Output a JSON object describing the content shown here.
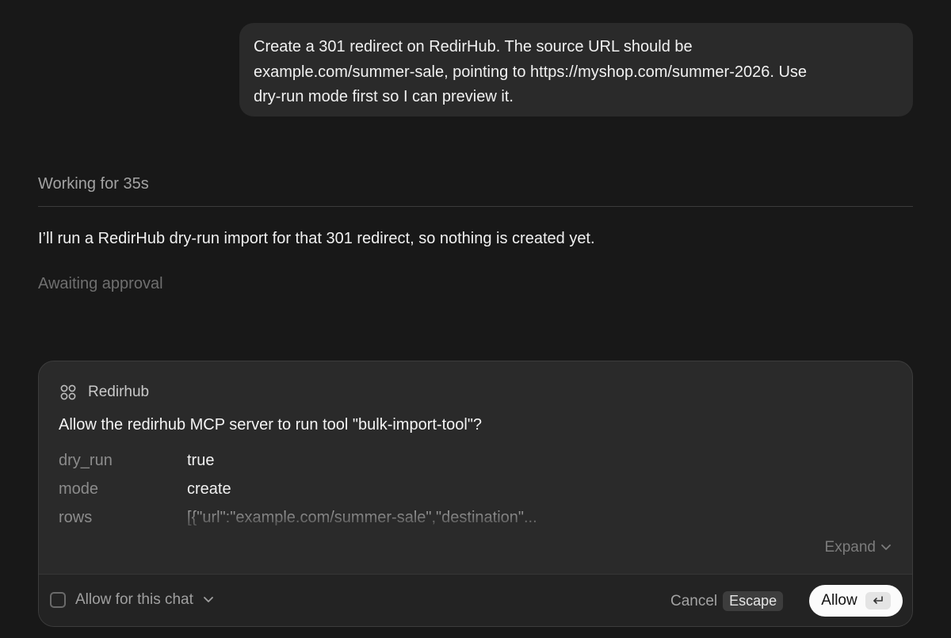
{
  "conversation": {
    "user_message_lines": [
      "Create a 301 redirect on RedirHub. The source URL should be",
      "example.com/summer-sale, pointing to https://myshop.com/summer-2026. Use",
      "dry-run mode first so I can preview it."
    ],
    "working_status": "Working for 35s",
    "assistant_message": "I’ll run a RedirHub dry-run import for that 301 redirect, so nothing is created yet.",
    "approval_status": "Awaiting approval"
  },
  "approval_card": {
    "server_icon": "grid-dots-icon",
    "server_name": "Redirhub",
    "question": "Allow the redirhub MCP server to run tool \"bulk-import-tool\"?",
    "params": [
      {
        "key": "dry_run",
        "value": "true"
      },
      {
        "key": "mode",
        "value": "create"
      },
      {
        "key": "rows",
        "value": "[{\"url\":\"example.com/summer-sale\",\"destination\"..."
      }
    ],
    "expand_label": "Expand",
    "allow_for_chat_label": "Allow for this chat",
    "allow_for_chat_checked": false,
    "cancel_label": "Cancel",
    "cancel_shortcut": "Escape",
    "allow_label": "Allow"
  },
  "colors": {
    "background": "#181818",
    "bubble": "#2a2a2a",
    "card": "#2a2a2a",
    "allow_button": "#fbfbfb"
  }
}
